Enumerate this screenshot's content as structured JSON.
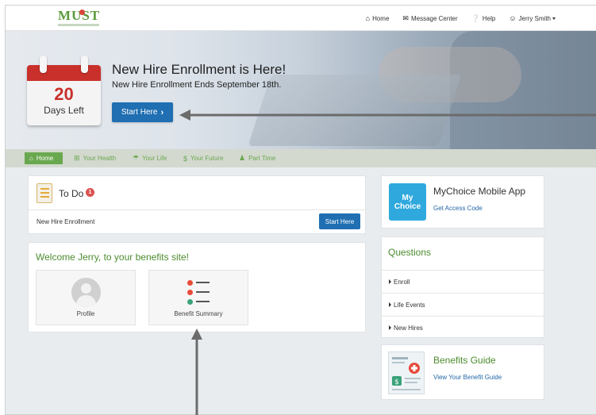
{
  "brand": {
    "logo_text": "MUST",
    "logo_color": "#5a9a3a"
  },
  "topnav": {
    "home": "Home",
    "messages": "Message Center",
    "help": "Help",
    "user": "Jerry Smith"
  },
  "hero": {
    "days_number": "20",
    "days_label": "Days Left",
    "title": "New Hire Enrollment is Here!",
    "subtitle": "New Hire Enrollment Ends September 18th.",
    "start_button": "Start Here"
  },
  "subnav": {
    "tabs": [
      {
        "label": "Home",
        "icon": "home-icon",
        "active": true
      },
      {
        "label": "Your Health",
        "icon": "plus-square-icon",
        "active": false
      },
      {
        "label": "Your Life",
        "icon": "umbrella-icon",
        "active": false
      },
      {
        "label": "Your Future",
        "icon": "dollar-icon",
        "active": false
      },
      {
        "label": "Part Time",
        "icon": "people-icon",
        "active": false
      }
    ],
    "accent": "#6aa84f"
  },
  "todo": {
    "title": "To Do",
    "badge": "1",
    "row_label": "New Hire Enrollment",
    "row_button": "Start Here"
  },
  "welcome": {
    "title": "Welcome Jerry, to your benefits site!",
    "tiles": [
      {
        "label": "Profile",
        "icon": "user-avatar-icon"
      },
      {
        "label": "Benefit Summary",
        "icon": "benefit-list-icon"
      }
    ]
  },
  "mychoice": {
    "logo_line1": "My",
    "logo_line2": "Choice",
    "title": "MyChoice Mobile App",
    "link": "Get Access Code"
  },
  "questions": {
    "title": "Questions",
    "items": [
      "Enroll",
      "Life Events",
      "New Hires"
    ]
  },
  "guide": {
    "title": "Benefits Guide",
    "link": "View Your Benefit Guide"
  },
  "colors": {
    "primary_button": "#1f6fb2",
    "green_heading": "#4c8c2f",
    "badge_red": "#d9534f",
    "link_blue": "#2366a8"
  }
}
